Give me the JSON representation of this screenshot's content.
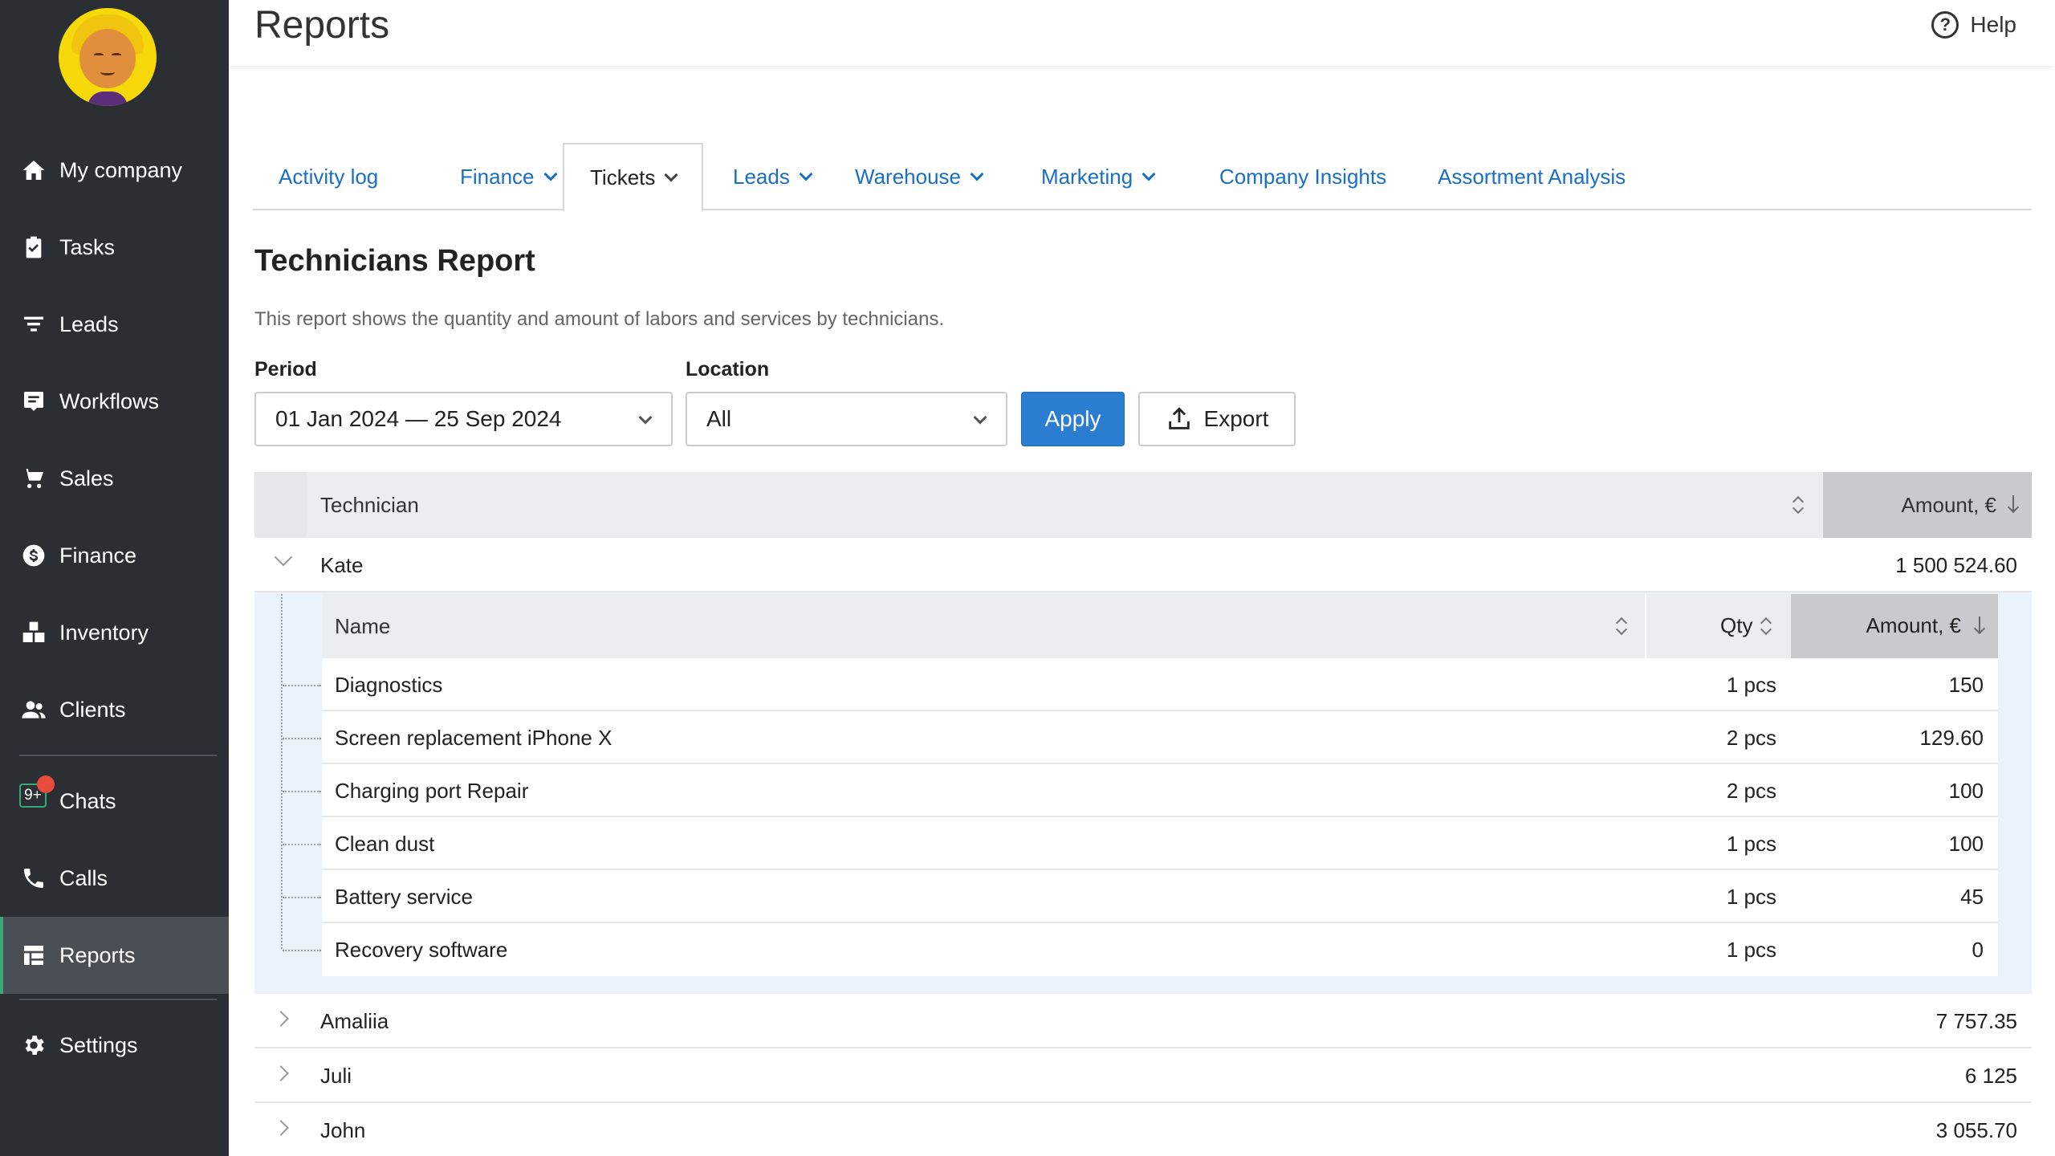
{
  "sidebar": {
    "items": [
      {
        "label": "My company",
        "icon": "home-icon"
      },
      {
        "label": "Tasks",
        "icon": "clipboard-check-icon"
      },
      {
        "label": "Leads",
        "icon": "filter-icon"
      },
      {
        "label": "Workflows",
        "icon": "workflow-icon"
      },
      {
        "label": "Sales",
        "icon": "cart-icon"
      },
      {
        "label": "Finance",
        "icon": "dollar-icon"
      },
      {
        "label": "Inventory",
        "icon": "boxes-icon"
      },
      {
        "label": "Clients",
        "icon": "users-icon"
      },
      {
        "label": "Chats",
        "icon": "chat-icon",
        "badge": "9+"
      },
      {
        "label": "Calls",
        "icon": "phone-icon"
      },
      {
        "label": "Reports",
        "icon": "reports-icon",
        "active": true
      },
      {
        "label": "Settings",
        "icon": "gear-icon"
      }
    ]
  },
  "header": {
    "title": "Reports",
    "help_label": "Help"
  },
  "tabs": [
    {
      "label": "Activity log",
      "dropdown": false
    },
    {
      "label": "Finance",
      "dropdown": true
    },
    {
      "label": "Tickets",
      "dropdown": true,
      "active": true
    },
    {
      "label": "Leads",
      "dropdown": true
    },
    {
      "label": "Warehouse",
      "dropdown": true
    },
    {
      "label": "Marketing",
      "dropdown": true
    },
    {
      "label": "Company Insights",
      "dropdown": false
    },
    {
      "label": "Assortment Analysis",
      "dropdown": false
    }
  ],
  "report": {
    "title": "Technicians Report",
    "description": "This report shows the quantity and amount of labors and services by technicians."
  },
  "filters": {
    "period_label": "Period",
    "period_value": "01 Jan 2024 — 25 Sep 2024",
    "location_label": "Location",
    "location_value": "All",
    "apply_label": "Apply",
    "export_label": "Export"
  },
  "table": {
    "col_technician": "Technician",
    "col_amount": "Amount, €",
    "rows": [
      {
        "name": "Kate",
        "amount": "1 500 524.60",
        "expanded": true
      },
      {
        "name": "Amaliia",
        "amount": "7 757.35",
        "expanded": false
      },
      {
        "name": "Juli",
        "amount": "6 125",
        "expanded": false
      },
      {
        "name": "John",
        "amount": "3 055.70",
        "expanded": false
      }
    ]
  },
  "subtable": {
    "col_name": "Name",
    "col_qty": "Qty",
    "col_amount": "Amount, €",
    "rows": [
      {
        "name": "Diagnostics",
        "qty": "1 pcs",
        "amount": "150"
      },
      {
        "name": "Screen replacement iPhone X",
        "qty": "2 pcs",
        "amount": "129.60"
      },
      {
        "name": "Charging port Repair",
        "qty": "2 pcs",
        "amount": "100"
      },
      {
        "name": "Clean dust",
        "qty": "1 pcs",
        "amount": "100"
      },
      {
        "name": "Battery service",
        "qty": "1 pcs",
        "amount": "45"
      },
      {
        "name": "Recovery software",
        "qty": "1 pcs",
        "amount": "0"
      }
    ]
  },
  "colors": {
    "sidebar_bg": "#2b2f33",
    "accent": "#2a7dd1",
    "link": "#1a6fc4",
    "active_marker": "#3ba776",
    "badge": "#e74c3c"
  }
}
